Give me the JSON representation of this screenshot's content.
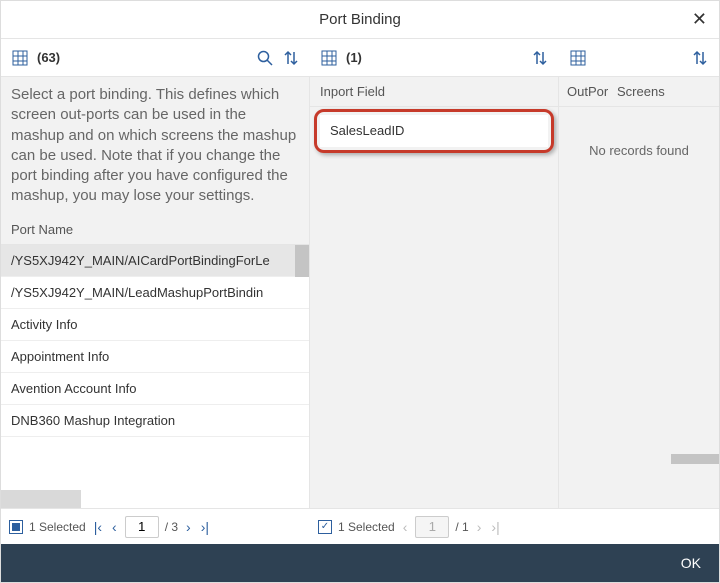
{
  "dialog": {
    "title": "Port Binding"
  },
  "toolbars": {
    "left": {
      "count": "(63)"
    },
    "mid": {
      "count": "(1)"
    }
  },
  "left": {
    "description": "Select a port binding. This defines which screen out-ports can be used in the mashup and on which screens the mashup can be used. Note that if you change the port binding after you have configured the mashup, you may lose your settings.",
    "header": "Port Name",
    "rows": [
      "/YS5XJ942Y_MAIN/AICardPortBindingForLe",
      "/YS5XJ942Y_MAIN/LeadMashupPortBindin",
      "Activity Info",
      "Appointment Info",
      "Avention Account Info",
      "DNB360 Mashup Integration"
    ],
    "pager": {
      "selected": "1 Selected",
      "page": "1",
      "pages": "/ 3"
    }
  },
  "mid": {
    "header": "Inport Field",
    "row": "SalesLeadID",
    "pager": {
      "selected": "1 Selected",
      "page": "1",
      "pages": "/ 1"
    }
  },
  "right": {
    "headers": [
      "OutPor",
      "Screens"
    ],
    "empty": "No records found"
  },
  "footer": {
    "ok": "OK"
  }
}
